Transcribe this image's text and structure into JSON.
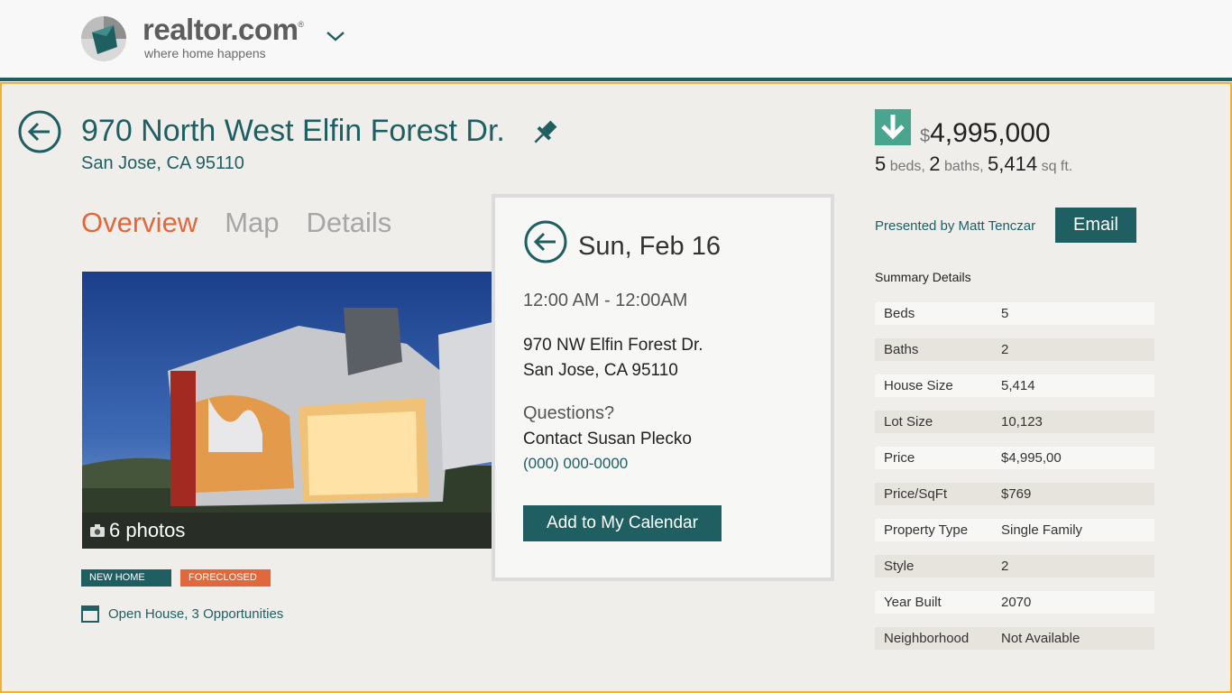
{
  "header": {
    "brand": "realtor.com",
    "registered": "®",
    "tagline": "where home happens",
    "menu_icon": "chevron-down-icon",
    "colors": {
      "brand_teal": "#1f5f62",
      "accent_orange": "#e0683b",
      "highlight_yellow": "#f2b035"
    }
  },
  "listing": {
    "address_line": "970 North West Elfin Forest Dr.",
    "city_line": "San Jose, CA 95110",
    "tabs": [
      {
        "label": "Overview",
        "active": true
      },
      {
        "label": "Map",
        "active": false
      },
      {
        "label": "Details",
        "active": false
      }
    ],
    "photo_count": "6 photos",
    "badges": {
      "new": "NEW HOME",
      "foreclosed": "FORECLOSED"
    },
    "open_house": "Open House, 3 Opportunities"
  },
  "popup": {
    "date": "Sun, Feb 16",
    "time": "12:00 AM - 12:00AM",
    "address_line1": "970 NW Elfin Forest Dr.",
    "address_line2": "San Jose, CA 95110",
    "questions": "Questions?",
    "contact": "Contact Susan Plecko",
    "phone": "(000) 000-0000",
    "button": "Add to My Calendar"
  },
  "pricing": {
    "currency": "$",
    "price": "4,995,000",
    "beds": "5",
    "beds_label": "beds,",
    "baths": "2",
    "baths_label": "baths,",
    "sqft": "5,414",
    "sqft_label": "sq ft."
  },
  "agent": {
    "presented_by": "Presented by Matt Tenczar",
    "email_button": "Email"
  },
  "summary": {
    "title": "Summary Details",
    "rows": [
      {
        "key": "Beds",
        "value": "5"
      },
      {
        "key": "Baths",
        "value": "2"
      },
      {
        "key": "House Size",
        "value": "5,414"
      },
      {
        "key": "Lot Size",
        "value": "10,123"
      },
      {
        "key": "Price",
        "value": "$4,995,00"
      },
      {
        "key": "Price/SqFt",
        "value": "$769"
      },
      {
        "key": "Property Type",
        "value": "Single Family"
      },
      {
        "key": "Style",
        "value": "2"
      },
      {
        "key": "Year Built",
        "value": "2070"
      },
      {
        "key": "Neighborhood",
        "value": "Not Available"
      }
    ]
  }
}
